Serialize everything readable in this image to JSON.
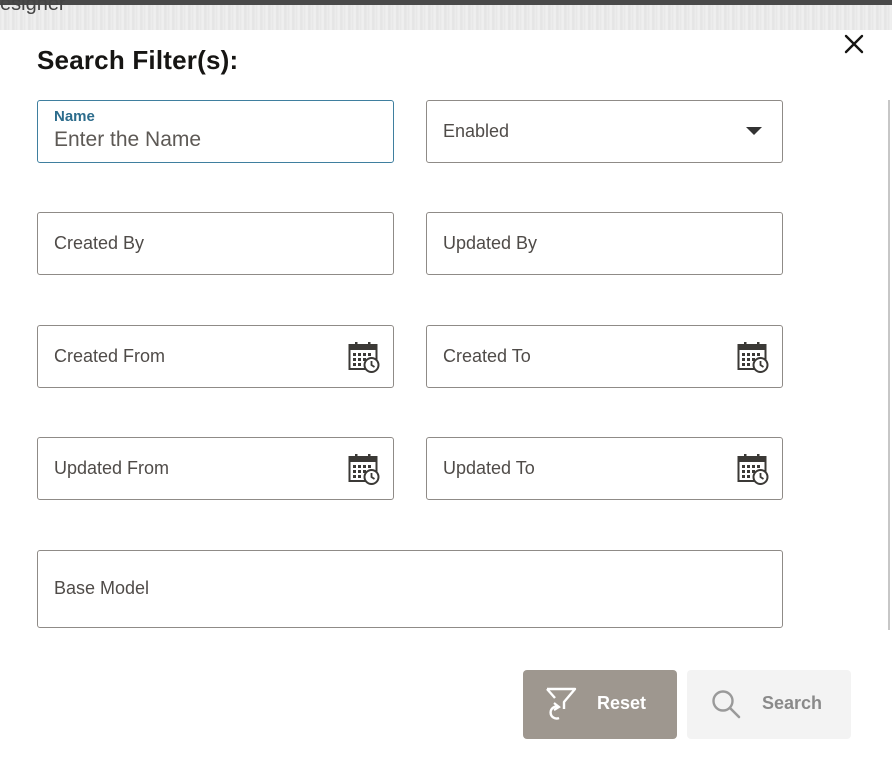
{
  "background_window": {
    "partial_title": "esigner"
  },
  "dialog": {
    "title": "Search Filter(s):",
    "close_icon": "close-icon"
  },
  "fields": {
    "name": {
      "label": "Name",
      "placeholder": "Enter the Name",
      "value": ""
    },
    "enabled": {
      "label": "Enabled"
    },
    "created_by": {
      "label": "Created By"
    },
    "updated_by": {
      "label": "Updated By"
    },
    "created_from": {
      "label": "Created From"
    },
    "created_to": {
      "label": "Created To"
    },
    "updated_from": {
      "label": "Updated From"
    },
    "updated_to": {
      "label": "Updated To"
    },
    "base_model": {
      "label": "Base Model"
    }
  },
  "buttons": {
    "reset": "Reset",
    "search": "Search"
  },
  "colors": {
    "reset_bg": "#9e978f",
    "search_bg": "#f3f3f3",
    "focus_label": "#2c6c8c",
    "field_border": "#8f8b87"
  }
}
